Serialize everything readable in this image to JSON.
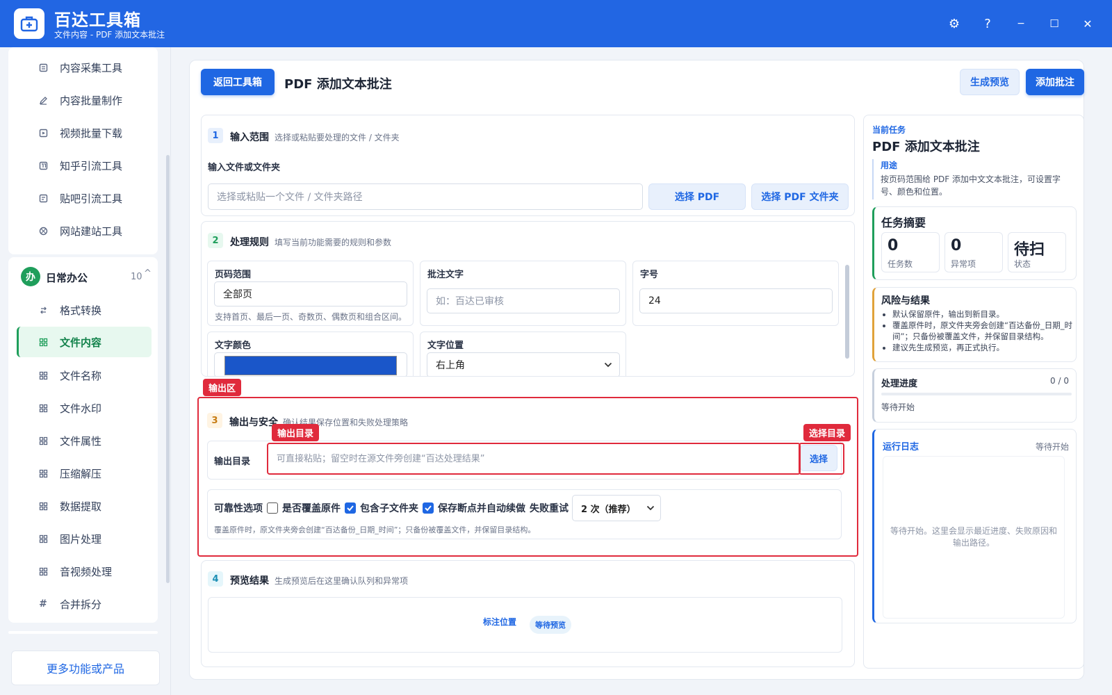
{
  "app": {
    "title": "百达工具箱",
    "subtitle": "文件内容 - PDF 添加文本批注"
  },
  "window_controls": {
    "settings": "⚙",
    "help": "?",
    "minimize": "−",
    "maximize": "☐",
    "close": "✕"
  },
  "sidebar": {
    "top_items": [
      {
        "label": "内容采集工具",
        "icon": "document-icon"
      },
      {
        "label": "内容批量制作",
        "icon": "pen-icon"
      },
      {
        "label": "视频批量下载",
        "icon": "video-icon"
      },
      {
        "label": "知乎引流工具",
        "icon": "zhihu-icon"
      },
      {
        "label": "贴吧引流工具",
        "icon": "message-icon"
      },
      {
        "label": "网站建站工具",
        "icon": "globe-icon"
      }
    ],
    "group": {
      "badge": "办",
      "title": "日常办公",
      "count": "10",
      "toggle": "^"
    },
    "group_items": [
      {
        "label": "格式转换",
        "icon": "swap-icon"
      },
      {
        "label": "文件内容",
        "icon": "grid-icon"
      },
      {
        "label": "文件名称",
        "icon": "grid-icon"
      },
      {
        "label": "文件水印",
        "icon": "grid-icon"
      },
      {
        "label": "文件属性",
        "icon": "grid-icon"
      },
      {
        "label": "压缩解压",
        "icon": "grid-icon"
      },
      {
        "label": "数据提取",
        "icon": "grid-icon"
      },
      {
        "label": "图片处理",
        "icon": "grid-icon"
      },
      {
        "label": "音视频处理",
        "icon": "grid-icon"
      },
      {
        "label": "合并拆分",
        "icon": "hash-icon"
      }
    ],
    "hash_glyph": "#",
    "active_item": "文件内容",
    "more_link": "更多功能或产品"
  },
  "header": {
    "back_button": "返回工具箱",
    "page_title": "PDF 添加文本批注",
    "preview_button": "生成预览",
    "add_button": "添加批注"
  },
  "section1": {
    "num": "1",
    "title": "输入范围",
    "hint": "选择或粘贴要处理的文件 / 文件夹",
    "field_label": "输入文件或文件夹",
    "input_placeholder": "选择或粘贴一个文件 / 文件夹路径",
    "select_pdf": "选择 PDF",
    "select_folder": "选择 PDF 文件夹"
  },
  "section2": {
    "num": "2",
    "title": "处理规则",
    "hint": "填写当前功能需要的规则和参数",
    "page_range_label": "页码范围",
    "page_range_value": "全部页",
    "page_range_hint": "支持首页、最后一页、奇数页、偶数页和组合区间。",
    "annotation_label": "批注文字",
    "annotation_placeholder": "如：百达已审核",
    "font_size_label": "字号",
    "font_size_value": "24",
    "color_label": "文字颜色",
    "color_value": "#1a56c9",
    "position_label": "文字位置",
    "position_value": "右上角"
  },
  "section3": {
    "tag_area": "输出区",
    "tag_dir": "输出目录",
    "tag_select": "选择目录",
    "num": "3",
    "title": "输出与安全",
    "hint": "确认结果保存位置和失败处理策略",
    "output_label": "输出目录",
    "output_placeholder": "可直接粘贴；留空时在源文件旁创建“百达处理结果”",
    "select_button": "选择",
    "reliability_label": "可靠性选项",
    "overwrite_label": "是否覆盖原件",
    "overwrite_checked": false,
    "subfolder_label": "包含子文件夹",
    "subfolder_checked": true,
    "resume_label": "保存断点并自动续做",
    "resume_checked": true,
    "retry_label": "失败重试",
    "retry_value": "2 次（推荐）",
    "note": "覆盖原件时，原文件夹旁会创建“百达备份_日期_时间”；只备份被覆盖文件，并保留目录结构。"
  },
  "section4": {
    "num": "4",
    "title": "预览结果",
    "hint": "生成预览后在这里确认队列和异常项",
    "col_label": "标注位置",
    "status_badge": "等待预览"
  },
  "right_panel": {
    "current_task_label": "当前任务",
    "task_title": "PDF 添加文本批注",
    "purpose_label": "用途",
    "purpose_text": "按页码范围给 PDF 添加中文文本批注，可设置字号、颜色和位置。",
    "summary_title": "任务摘要",
    "stats": [
      {
        "value": "0",
        "label": "任务数"
      },
      {
        "value": "0",
        "label": "异常项"
      },
      {
        "value": "待扫",
        "label": "状态"
      }
    ],
    "risk_title": "风险与结果",
    "risk_items": [
      "默认保留原件，输出到新目录。",
      "覆盖原件时，原文件夹旁会创建“百达备份_日期_时间”；只备份被覆盖文件，并保留目录结构。",
      "建议先生成预览，再正式执行。"
    ],
    "progress_title": "处理进度",
    "progress_count": "0 / 0",
    "progress_fraction": 0,
    "progress_status": "等待开始",
    "log_title": "运行日志",
    "log_status": "等待开始",
    "log_placeholder": "等待开始。这里会显示最近进度、失败原因和输出路径。"
  },
  "colors": {
    "brand": "#2266e3",
    "active_green": "#1f9e5b",
    "annotation_red": "#e02a3c"
  }
}
